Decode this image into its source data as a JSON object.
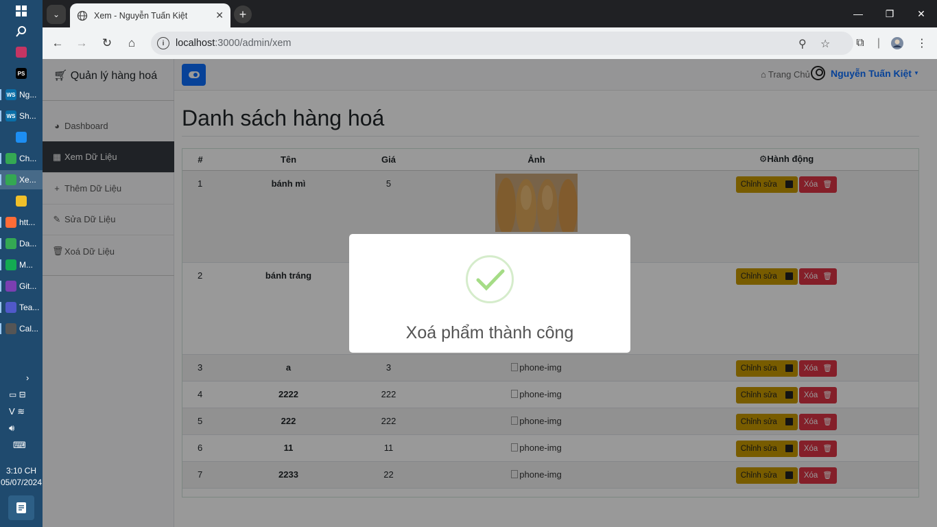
{
  "taskbar": {
    "apps": [
      {
        "label": "",
        "icon": "intellij-icon",
        "color": "#c53563"
      },
      {
        "label": "",
        "icon": "phpstorm-icon",
        "color": "#000000",
        "glyph": "PS"
      },
      {
        "label": "Ng...",
        "icon": "webstorm-icon",
        "color": "#0a6fa8",
        "glyph": "WS"
      },
      {
        "label": "Sh...",
        "icon": "webstorm-icon",
        "color": "#0a6fa8",
        "glyph": "WS"
      },
      {
        "label": "",
        "icon": "zalo-icon",
        "color": "#1d8ef2",
        "glyph": "Zalo"
      },
      {
        "label": "Ch...",
        "icon": "chrome-icon",
        "color": "#34a853"
      },
      {
        "label": "Xe...",
        "icon": "chrome-icon",
        "color": "#34a853"
      },
      {
        "label": "",
        "icon": "file-explorer-icon",
        "color": "#f0c02a"
      },
      {
        "label": "htt...",
        "icon": "postman-icon",
        "color": "#ff6c37"
      },
      {
        "label": "Da...",
        "icon": "chrome-icon",
        "color": "#34a853"
      },
      {
        "label": "M...",
        "icon": "mongodb-compass-icon",
        "color": "#13aa52"
      },
      {
        "label": "Git...",
        "icon": "github-desktop-icon",
        "color": "#7b3fb1"
      },
      {
        "label": "Tea...",
        "icon": "teams-icon",
        "color": "#5059c9"
      },
      {
        "label": "Cal...",
        "icon": "calculator-icon",
        "color": "#555555"
      }
    ],
    "time": "3:10 CH",
    "date": "05/07/2024"
  },
  "browser": {
    "tab_title": "Xem - Nguyễn Tuấn Kiệt",
    "url_host": "localhost",
    "url_path": ":3000/admin/xem"
  },
  "sidebar": {
    "brand": "Quản lý hàng hoá",
    "items": [
      {
        "label": "Dashboard",
        "icon": "dashboard-icon",
        "glyph": "◕"
      },
      {
        "label": "Xem Dữ Liệu",
        "icon": "table-icon",
        "glyph": "▦"
      },
      {
        "label": "Thêm Dữ Liệu",
        "icon": "plus-icon",
        "glyph": "+"
      },
      {
        "label": "Sửa Dữ Liệu",
        "icon": "pencil-icon",
        "glyph": "✎"
      },
      {
        "label": "Xoá Dữ Liệu",
        "icon": "trash-icon",
        "glyph": "🗑"
      }
    ]
  },
  "topbar": {
    "home_label": "Trang Chủ",
    "user_name": "Nguyễn Tuấn Kiệt"
  },
  "main": {
    "title": "Danh sách hàng hoá",
    "table": {
      "headers": [
        "#",
        "Tên",
        "Giá",
        "Ảnh",
        "Hành động"
      ],
      "rows": [
        {
          "id": "1",
          "name": "bánh mì",
          "price": "5",
          "image": "bread-photo"
        },
        {
          "id": "2",
          "name": "bánh tráng",
          "price": "",
          "image": ""
        },
        {
          "id": "3",
          "name": "a",
          "price": "3",
          "image": "phone-img"
        },
        {
          "id": "4",
          "name": "2222",
          "price": "222",
          "image": "phone-img"
        },
        {
          "id": "5",
          "name": "222",
          "price": "222",
          "image": "phone-img"
        },
        {
          "id": "6",
          "name": "11",
          "price": "11",
          "image": "phone-img"
        },
        {
          "id": "7",
          "name": "2233",
          "price": "22",
          "image": "phone-img"
        }
      ],
      "edit_label": "Chỉnh sửa",
      "delete_label": "Xóa"
    }
  },
  "modal": {
    "title": "Xoá phẩm thành công",
    "icon": "success-check-icon"
  }
}
